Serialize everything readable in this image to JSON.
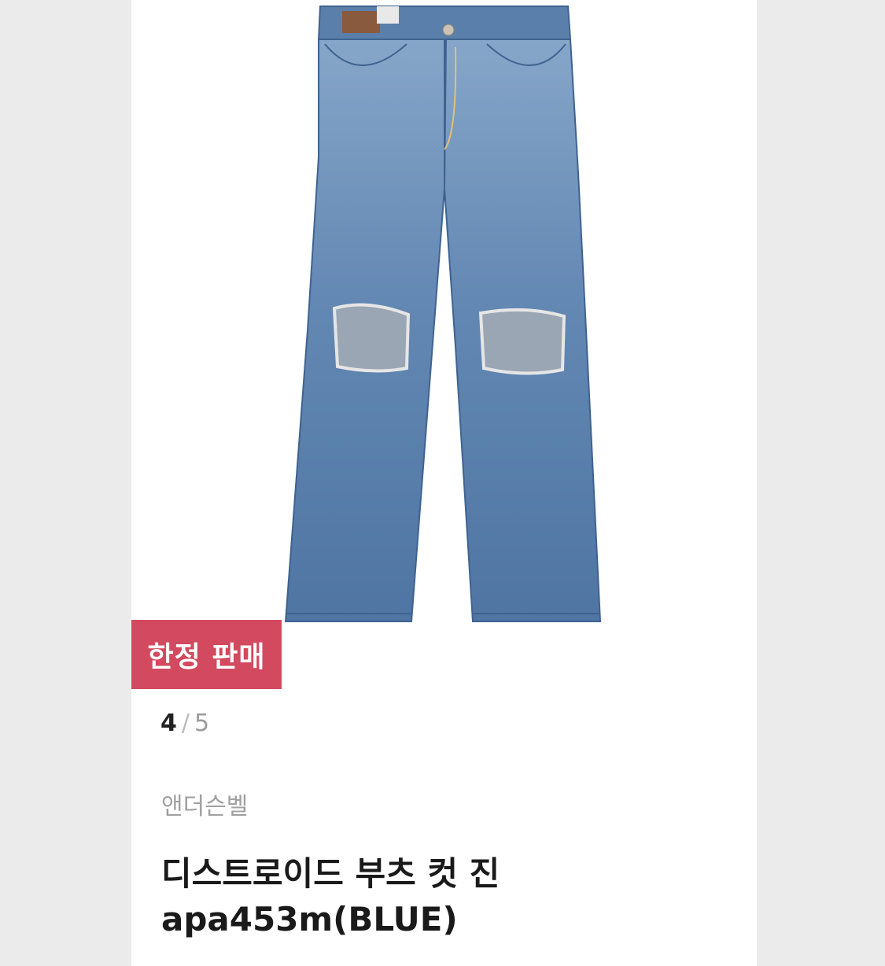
{
  "badge": {
    "label": "한정 판매"
  },
  "pager": {
    "current": "4",
    "separator": "/",
    "total": "5"
  },
  "product": {
    "brand": "앤더슨벨",
    "title": "디스트로이드 부츠 컷 진 apa453m(BLUE)",
    "image_icon": "denim-jeans-image"
  },
  "colors": {
    "badge": "#d3495f",
    "denim": "#5f83ad",
    "background": "#ebebeb"
  },
  "scroll_top": {
    "icon": "arrow-up-icon"
  }
}
